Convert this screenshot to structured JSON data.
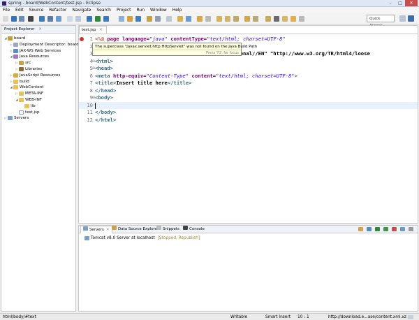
{
  "window": {
    "title": "spring - board/WebContent/test.jsp - Eclipse"
  },
  "menu": [
    "File",
    "Edit",
    "Source",
    "Refactor",
    "Navigate",
    "Search",
    "Project",
    "Run",
    "Window",
    "Help"
  ],
  "quick_access": "Quick Access",
  "explorer": {
    "title": "Project Explorer",
    "tree": [
      {
        "label": "board",
        "level": 0,
        "icon": "proj",
        "expanded": true
      },
      {
        "label": "Deployment Descriptor: board",
        "level": 1,
        "icon": "desc",
        "expanded": false
      },
      {
        "label": "JAX-WS Web Services",
        "level": 1,
        "icon": "ws",
        "expanded": false
      },
      {
        "label": "Java Resources",
        "level": 1,
        "icon": "java",
        "expanded": true
      },
      {
        "label": "src",
        "level": 2,
        "icon": "src",
        "expanded": false
      },
      {
        "label": "Libraries",
        "level": 2,
        "icon": "lib",
        "expanded": false
      },
      {
        "label": "JavaScript Resources",
        "level": 1,
        "icon": "js",
        "expanded": false
      },
      {
        "label": "build",
        "level": 1,
        "icon": "folder",
        "expanded": false
      },
      {
        "label": "WebContent",
        "level": 1,
        "icon": "folder",
        "expanded": true
      },
      {
        "label": "META-INF",
        "level": 2,
        "icon": "folder",
        "expanded": false
      },
      {
        "label": "WEB-INF",
        "level": 2,
        "icon": "folder",
        "expanded": true
      },
      {
        "label": "lib",
        "level": 3,
        "icon": "folder",
        "expanded": null
      },
      {
        "label": "test.jsp",
        "level": 2,
        "icon": "file",
        "expanded": null
      },
      {
        "label": "Servers",
        "level": 0,
        "icon": "srv",
        "expanded": false
      }
    ]
  },
  "editor": {
    "tab": "test.jsp",
    "line_numbers": [
      "1",
      "2",
      "3",
      "4",
      "5",
      "6",
      "7",
      "8",
      "9",
      "10",
      "11",
      "12"
    ],
    "lines": [
      [
        [
          "dir",
          "<%@ "
        ],
        [
          "kw",
          "page "
        ],
        [
          "at",
          "language="
        ],
        [
          "val",
          "\"java\" "
        ],
        [
          "at",
          "contentType="
        ],
        [
          "val",
          "\"text/html; charset=UTF-8\""
        ]
      ],
      [],
      [
        [
          "txt",
          "                                        transitional//EN\" \"http://www.w3.org/TR/html4/loose"
        ]
      ],
      [
        [
          "tag",
          "<html>"
        ]
      ],
      [
        [
          "tag",
          "<head>"
        ]
      ],
      [
        [
          "tag",
          "<meta "
        ],
        [
          "at",
          "http-equiv="
        ],
        [
          "val",
          "\"Content-Type\" "
        ],
        [
          "at",
          "content="
        ],
        [
          "val",
          "\"text/html; charset=UTF-8\""
        ],
        [
          "tag",
          ">"
        ]
      ],
      [
        [
          "tag",
          "<title>"
        ],
        [
          "txt",
          "Insert title here"
        ],
        [
          "tag",
          "</title>"
        ]
      ],
      [
        [
          "tag",
          "</head>"
        ]
      ],
      [
        [
          "tag",
          "<body>"
        ]
      ],
      [],
      [
        [
          "tag",
          "</body>"
        ]
      ],
      [
        [
          "tag",
          "</html>"
        ]
      ]
    ],
    "tooltip": {
      "message": "The superclass \"javax.servlet.http.HttpServlet\" was not found on the Java Build Path",
      "hint": "Press 'F2' for focus"
    }
  },
  "bottom": {
    "tabs": [
      "Servers",
      "Data Source Explorer",
      "Snippets",
      "Console"
    ],
    "server_name": "Tomcat v8.0 Server at localhost",
    "server_state": "[Stopped, Republish]"
  },
  "status": {
    "path": "html/body/#text",
    "writable": "Writable",
    "insert_mode": "Smart Insert",
    "position": "10 : 1",
    "download": "http://download.e...ase/content.xml.xz"
  },
  "colors": {
    "tag": "#3a6f82",
    "keyword": "#7f0055",
    "attribute": "#7f007f",
    "value": "#2a00ff",
    "error": "#d9302c",
    "current_line": "#e8f2fe"
  }
}
